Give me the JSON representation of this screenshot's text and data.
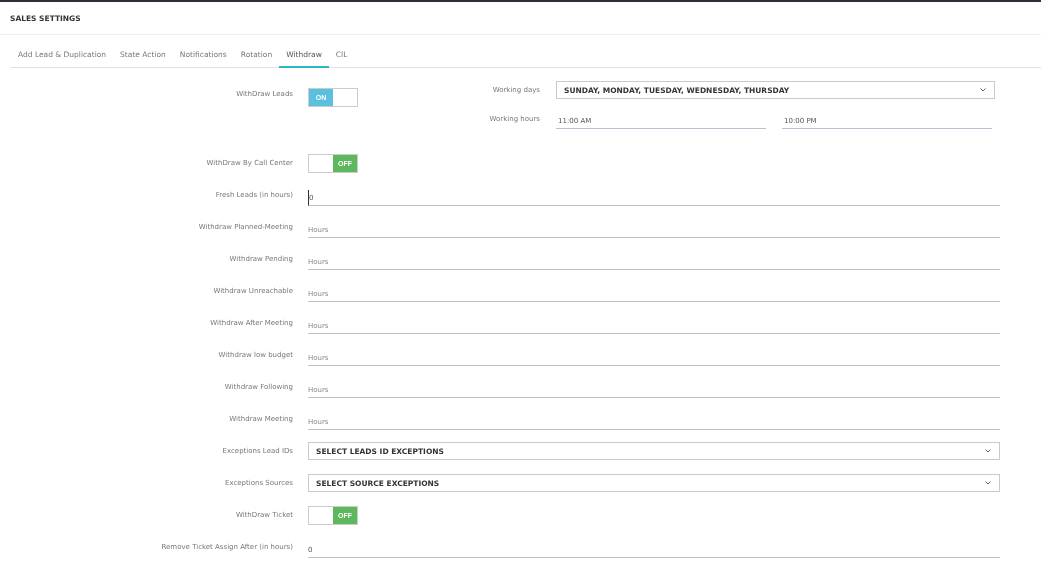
{
  "title": "SALES SETTINGS",
  "tabs": [
    {
      "label": "Add Lead & Duplication",
      "selected": false
    },
    {
      "label": "State Action",
      "selected": false
    },
    {
      "label": "Notifications",
      "selected": false
    },
    {
      "label": "Rotation",
      "selected": false
    },
    {
      "label": "Withdraw",
      "selected": true
    },
    {
      "label": "CIL",
      "selected": false
    }
  ],
  "withdraw_leads": {
    "label": "WithDraw Leads",
    "on": true,
    "text": "ON"
  },
  "working_days": {
    "label": "Working days",
    "value": "SUNDAY, MONDAY, TUESDAY, WEDNESDAY, THURSDAY"
  },
  "working_hours": {
    "label": "Working hours",
    "from": "11:00 AM",
    "to": "10:00 PM"
  },
  "fields": [
    {
      "kind": "toggle",
      "label": "WithDraw By Call Center",
      "on": false,
      "text": "OFF"
    },
    {
      "kind": "text",
      "label": "Fresh Leads (in hours)",
      "value": "0",
      "focused": true
    },
    {
      "kind": "text",
      "label": "Withdraw Planned-Meeting",
      "placeholder": "Hours"
    },
    {
      "kind": "text",
      "label": "Withdraw Pending",
      "placeholder": "Hours"
    },
    {
      "kind": "text",
      "label": "Withdraw Unreachable",
      "placeholder": "Hours"
    },
    {
      "kind": "text",
      "label": "Withdraw After Meeting",
      "placeholder": "Hours"
    },
    {
      "kind": "text",
      "label": "Withdraw low budget",
      "placeholder": "Hours"
    },
    {
      "kind": "text",
      "label": "Withdraw Following",
      "placeholder": "Hours"
    },
    {
      "kind": "text",
      "label": "Withdraw Meeting",
      "placeholder": "Hours"
    },
    {
      "kind": "select",
      "label": "Exceptions Lead IDs",
      "value": "SELECT LEADS ID EXCEPTIONS"
    },
    {
      "kind": "select",
      "label": "Exceptions Sources",
      "value": "SELECT SOURCE EXCEPTIONS"
    },
    {
      "kind": "toggle",
      "label": "WithDraw Ticket",
      "on": false,
      "text": "OFF"
    },
    {
      "kind": "text",
      "label": "Remove Ticket Assign After (in hours)",
      "value": "0"
    }
  ]
}
